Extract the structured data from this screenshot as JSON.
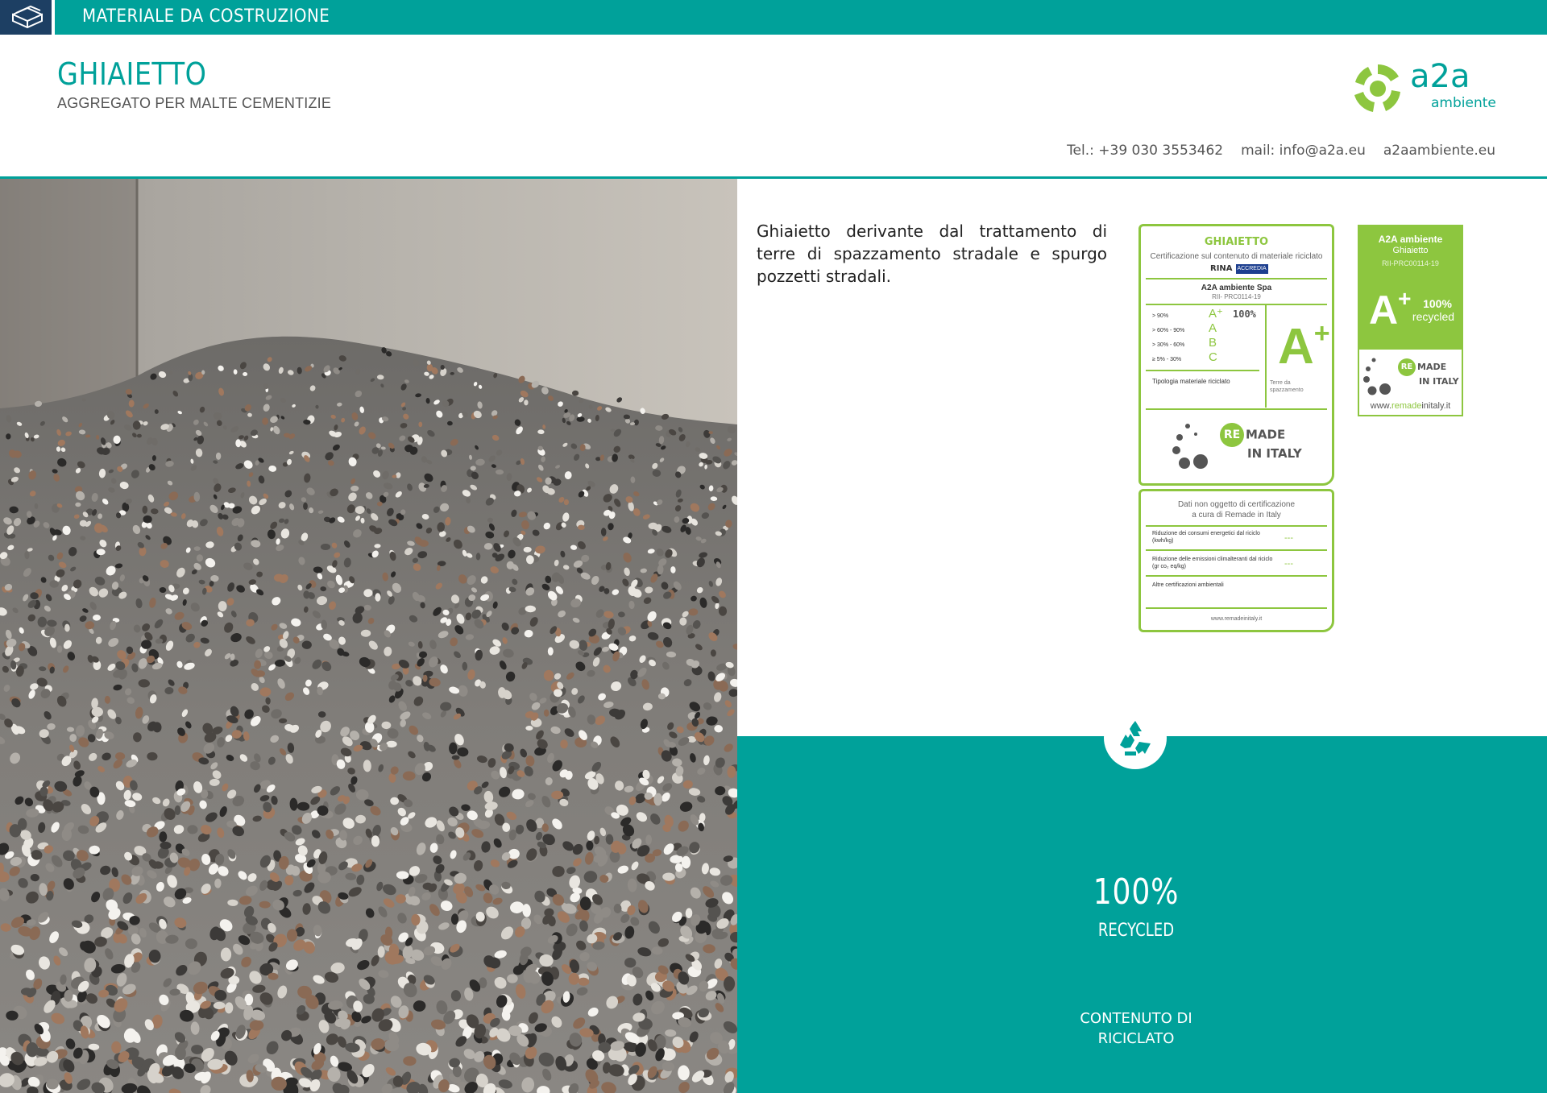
{
  "topbar": {
    "title": "MATERIALE DA COSTRUZIONE",
    "icon": "bricks-icon"
  },
  "header": {
    "title": "GHIAIETTO",
    "subtitle": "AGGREGATO PER MALTE CEMENTIZIE",
    "logo_main": "a2a",
    "logo_sub": "ambiente",
    "phone": "Tel.:  +39 030 3553462",
    "mail": "mail: info@a2a.eu",
    "site": "a2aambiente.eu"
  },
  "description": "Ghiaietto derivante dal trattamento di terre di spazzamento stradale e spurgo pozzetti stradali.",
  "certificate": {
    "title": "GHIAIETTO",
    "subtitle": "Certificazione sul contenuto di materiale riciclato",
    "logo_a": "RINA",
    "logo_b": "ACCREDIA",
    "company": "A2A ambiente Spa",
    "code": "RII- PRC0114-19",
    "ranges": [
      "> 90%",
      "> 60% - 90%",
      "> 30% - 60%",
      "≥ 5% - 30%"
    ],
    "classes": [
      "A⁺",
      "A",
      "B",
      "C"
    ],
    "percent": "100%",
    "grade": "A",
    "grade_sup": "+",
    "type_label": "Tipologia materiale riciclato",
    "type_value": "Terre da spazzamento",
    "remade_prefix": "RE",
    "remade_line1": "MADE",
    "remade_line2": "IN ITALY"
  },
  "certificate_extra": {
    "head_line1": "Dati non oggetto di certificazione",
    "head_line2": "a cura di Remade in Italy",
    "row1": "Riduzione dei consumi energetici dal riciclo (kwh/kg)",
    "row2": "Riduzione delle emissioni climalteranti dal riciclo (gr co₂ eq/kg)",
    "row3": "Altre certificazioni ambientali",
    "dash": "---",
    "footer": "www.remadeinitaly.it"
  },
  "label": {
    "company": "A2A ambiente",
    "product": "Ghiaietto",
    "code": "RII-PRC00114-19",
    "grade": "A",
    "grade_sup": "+",
    "percent": "100%",
    "recycled": "recycled",
    "remade_prefix": "RE",
    "remade_line1": "MADE",
    "remade_line2": "IN ITALY",
    "url_pre": "www.",
    "url_hi": "remade",
    "url_post": "initaly.it"
  },
  "panel": {
    "icon": "recycle-icon",
    "percent": "100%",
    "recycled": "RECYCLED",
    "content_line1": "CONTENUTO DI",
    "content_line2": "RICICLATO"
  },
  "colors": {
    "teal": "#00a19a",
    "navy": "#1d3f63",
    "green": "#8dc63f"
  }
}
